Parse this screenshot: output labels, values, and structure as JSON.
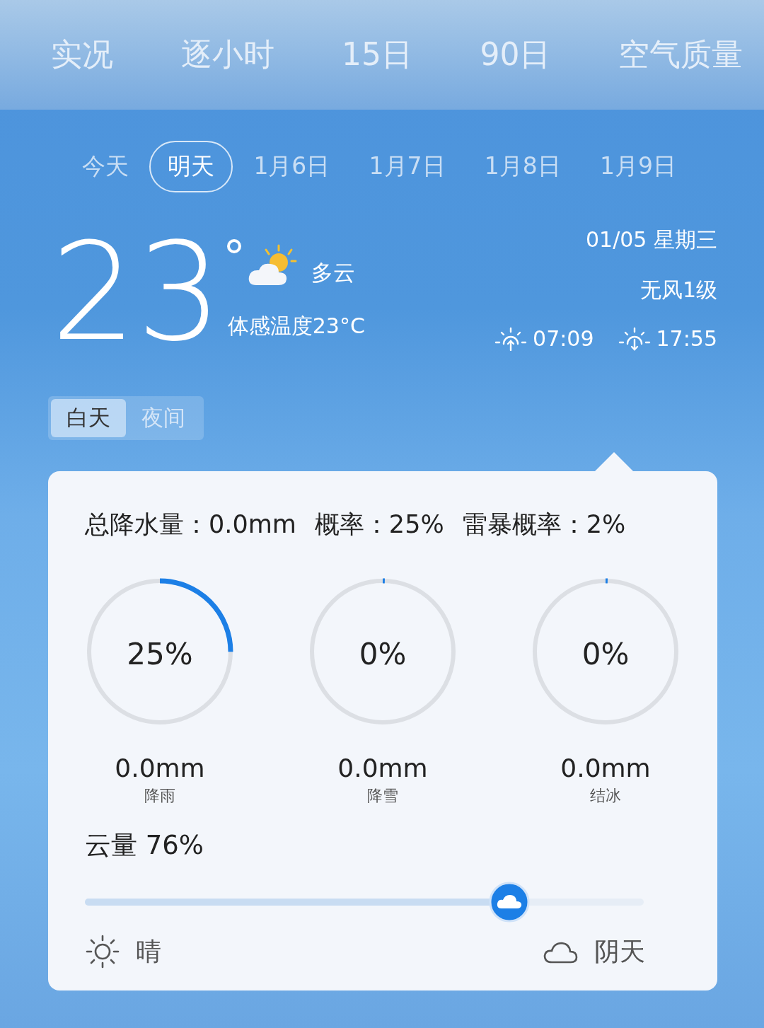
{
  "nav_tabs": [
    {
      "label": "实况"
    },
    {
      "label": "逐小时"
    },
    {
      "label": "15日"
    },
    {
      "label": "90日"
    },
    {
      "label": "空气质量"
    }
  ],
  "date_tabs": [
    {
      "label": "今天",
      "selected": false
    },
    {
      "label": "明天",
      "selected": true
    },
    {
      "label": "1月6日",
      "selected": false
    },
    {
      "label": "1月7日",
      "selected": false
    },
    {
      "label": "1月8日",
      "selected": false
    },
    {
      "label": "1月9日",
      "selected": false
    }
  ],
  "current": {
    "temperature": "23",
    "condition": "多云",
    "feels_like": "体感温度23°C",
    "date": "01/05 星期三",
    "wind": "无风1级",
    "sunrise": "07:09",
    "sunset": "17:55"
  },
  "period_toggle": [
    {
      "label": "白天",
      "selected": true
    },
    {
      "label": "夜间",
      "selected": false
    }
  ],
  "summary": [
    "总降水量：0.0mm",
    "概率：25%",
    "雷暴概率：2%"
  ],
  "gauges": [
    {
      "value": "25%",
      "level": 0.25,
      "amount": "0.0mm",
      "label": "降雨"
    },
    {
      "value": "0%",
      "level": 0,
      "amount": "0.0mm",
      "label": "降雪"
    },
    {
      "value": "0%",
      "level": 0,
      "amount": "0.0mm",
      "label": "结冰"
    }
  ],
  "cloud": {
    "title": "云量 76%",
    "level": 0.76,
    "left_label": "晴",
    "right_label": "阴天"
  }
}
